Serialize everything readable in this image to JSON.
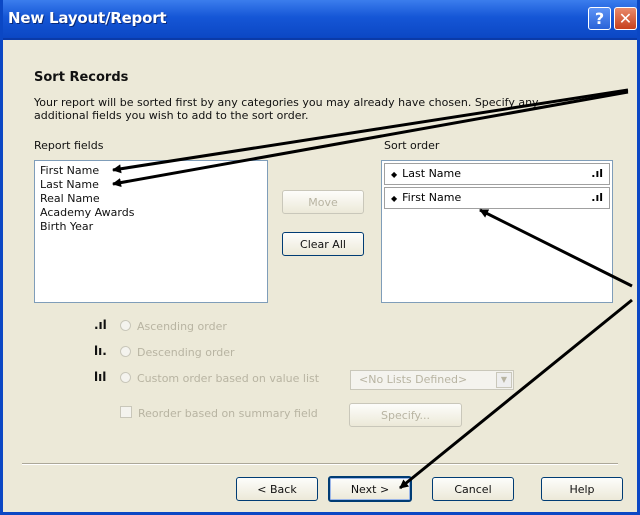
{
  "window": {
    "title": "New Layout/Report",
    "help_glyph": "?",
    "close_glyph": "✕"
  },
  "section_title": "Sort Records",
  "description": "Your report will be sorted first by any categories you may already have chosen. Specify any additional fields you wish to add to the sort order.",
  "report_fields": {
    "label": "Report fields",
    "items": [
      "First Name",
      "Last Name",
      "Real Name",
      "Academy Awards",
      "Birth Year"
    ]
  },
  "sort_order": {
    "label": "Sort order",
    "items": [
      {
        "label": "Last Name",
        "order_icon": "ascending-bars-icon"
      },
      {
        "label": "First Name",
        "order_icon": "ascending-bars-icon"
      }
    ]
  },
  "buttons": {
    "move": "Move",
    "clear_all": "Clear All",
    "specify": "Specify...",
    "back": "< Back",
    "next": "Next >",
    "cancel": "Cancel",
    "help": "Help"
  },
  "order_options": {
    "ascending": "Ascending order",
    "descending": "Descending order",
    "custom": "Custom order based on value list"
  },
  "value_list": {
    "selected": "<No Lists Defined>"
  },
  "reorder_checkbox": "Reorder based on summary field",
  "colors": {
    "titlebar": "#0b47c4",
    "dialog_bg": "#ece9d8",
    "disabled_text": "#b8b4a2",
    "annotation_arrows": "#000000"
  }
}
